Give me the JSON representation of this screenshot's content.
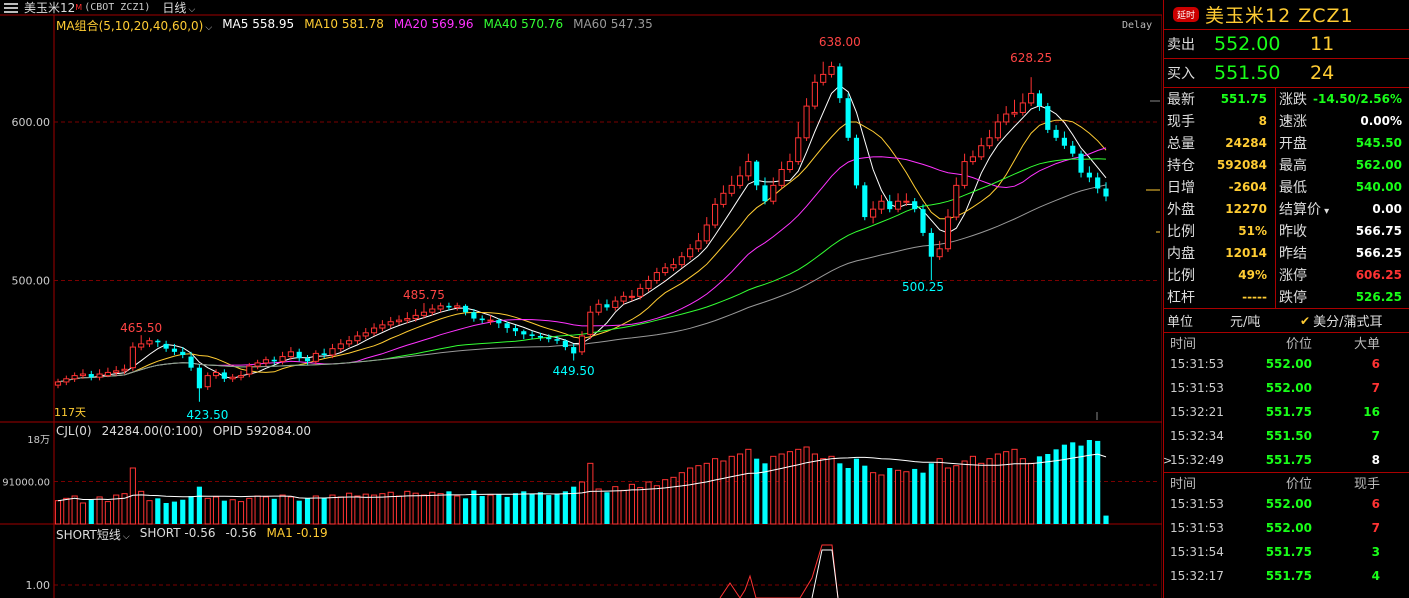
{
  "header": {
    "instrument": "美玉米12",
    "flag": "M",
    "code": "(CBOT ZCZ1)",
    "period": "日线"
  },
  "ma_legend": [
    {
      "label": "MA组合(5,10,20,40,60,0)",
      "color": "#ffcc33"
    },
    {
      "label": "MA5 558.95",
      "color": "#ffffff"
    },
    {
      "label": "MA10 581.78",
      "color": "#ffcc33"
    },
    {
      "label": "MA20 569.96",
      "color": "#ff33ff"
    },
    {
      "label": "MA40 570.76",
      "color": "#33ff33"
    },
    {
      "label": "MA60 547.35",
      "color": "#999999"
    }
  ],
  "delay_label": "Delay",
  "annotations": {
    "days": "117天",
    "high1": "465.50",
    "low1": "423.50",
    "high2": "485.75",
    "low2": "449.50",
    "high3": "638.00",
    "low3": "500.25",
    "high4": "628.25"
  },
  "vol_legend": {
    "name": "CJL(0)",
    "values": "24284.00(0:100)",
    "opid": "OPID 592084.00"
  },
  "short_legend": {
    "name": "SHORT短线",
    "v1": "SHORT -0.56",
    "v2": "-0.56",
    "v3": "MA1 -0.19"
  },
  "colors": {
    "up": "#ff3333",
    "down": "#00ffff",
    "ma5": "#ffffff",
    "ma10": "#ffcc33",
    "ma20": "#ff33ff",
    "ma40": "#33ff33",
    "ma60": "#999999"
  },
  "chart_data": {
    "type": "candlestick",
    "y_price_range": [
      412,
      658
    ],
    "y_ticks": [
      "600.00",
      "500.00"
    ],
    "y_tick_values": [
      600,
      500
    ],
    "vol_ticks": [
      "18万",
      "91000.00"
    ],
    "vol_tick_values": [
      180000,
      91000
    ],
    "vol_range": [
      0,
      180000
    ],
    "short_ticks": [
      "1.00"
    ],
    "price_close": [
      436,
      438,
      440,
      441,
      439,
      441,
      442,
      443,
      444,
      458,
      460,
      462,
      461,
      457,
      455,
      453,
      445,
      432,
      440,
      442,
      438,
      439,
      440,
      446,
      448,
      450,
      449,
      452,
      455,
      451,
      449,
      454,
      453,
      457,
      460,
      462,
      465,
      467,
      470,
      472,
      474,
      475,
      476,
      478,
      480,
      482,
      484,
      483,
      484,
      480,
      476,
      475,
      475,
      473,
      470,
      468,
      466,
      465,
      464,
      463,
      462,
      458,
      454,
      465,
      480,
      485,
      483,
      487,
      490,
      490,
      495,
      500,
      505,
      508,
      510,
      515,
      520,
      525,
      535,
      548,
      555,
      560,
      566,
      575,
      560,
      550,
      560,
      570,
      575,
      590,
      610,
      625,
      630,
      635,
      615,
      590,
      560,
      540,
      545,
      550,
      545,
      550,
      550,
      545,
      530,
      515,
      520,
      540,
      560,
      575,
      578,
      585,
      590,
      600,
      605,
      606,
      612,
      618,
      610,
      595,
      590,
      585,
      580,
      568,
      565,
      558,
      553
    ],
    "price_open": [
      434,
      436,
      438,
      440,
      441,
      439,
      440,
      442,
      443,
      445,
      458,
      460,
      462,
      460,
      457,
      455,
      452,
      445,
      433,
      440,
      442,
      438,
      439,
      441,
      446,
      448,
      450,
      449,
      452,
      455,
      451,
      449,
      454,
      453,
      457,
      460,
      462,
      465,
      467,
      470,
      472,
      474,
      475,
      476,
      478,
      480,
      482,
      484,
      483,
      484,
      480,
      476,
      475,
      475,
      473,
      470,
      468,
      466,
      465,
      464,
      463,
      462,
      458,
      455,
      466,
      480,
      485,
      483,
      487,
      490,
      490,
      495,
      500,
      505,
      508,
      510,
      515,
      520,
      525,
      535,
      548,
      555,
      560,
      566,
      575,
      560,
      550,
      560,
      570,
      575,
      590,
      610,
      625,
      630,
      635,
      615,
      590,
      560,
      540,
      545,
      550,
      545,
      550,
      550,
      545,
      530,
      515,
      520,
      540,
      560,
      575,
      578,
      585,
      590,
      600,
      605,
      606,
      612,
      618,
      610,
      595,
      590,
      585,
      580,
      568,
      565,
      558
    ],
    "price_high": [
      438,
      440,
      442,
      444,
      443,
      444,
      445,
      446,
      447,
      461,
      465.5,
      464,
      463,
      462,
      460,
      458,
      455,
      447,
      442,
      444,
      444,
      441,
      443,
      448,
      450,
      452,
      452,
      455,
      458,
      457,
      453,
      456,
      457,
      460,
      463,
      465,
      468,
      470,
      473,
      475,
      477,
      478,
      480,
      482,
      485.75,
      485,
      486,
      486,
      486,
      485,
      482,
      478,
      478,
      476,
      474,
      472,
      469,
      468,
      467,
      466,
      465,
      463,
      460,
      468,
      484,
      488,
      488,
      490,
      493,
      494,
      498,
      503,
      508,
      511,
      514,
      518,
      523,
      530,
      540,
      552,
      560,
      566,
      572,
      580,
      576,
      565,
      565,
      575,
      580,
      600,
      615,
      630,
      638,
      638,
      637,
      618,
      592,
      562,
      550,
      554,
      554,
      555,
      555,
      552,
      548,
      533,
      525,
      545,
      565,
      580,
      582,
      590,
      595,
      605,
      610,
      614,
      618,
      628.25,
      620,
      612,
      598,
      594,
      588,
      582,
      572,
      568,
      562
    ],
    "price_low": [
      432,
      434,
      436,
      438,
      437,
      437,
      439,
      440,
      441,
      443,
      456,
      458,
      458,
      455,
      453,
      451,
      443,
      423.5,
      431,
      438,
      436,
      436,
      437,
      439,
      444,
      446,
      447,
      447,
      450,
      449,
      447,
      447,
      451,
      451,
      455,
      458,
      460,
      463,
      465,
      468,
      470,
      472,
      473,
      474,
      476,
      478,
      480,
      481,
      481,
      478,
      474,
      473,
      472,
      470,
      467,
      465,
      463,
      463,
      462,
      461,
      460,
      456,
      449.5,
      453,
      463,
      478,
      481,
      481,
      485,
      487,
      488,
      493,
      498,
      503,
      506,
      508,
      513,
      518,
      523,
      533,
      546,
      553,
      558,
      563,
      557,
      548,
      548,
      558,
      568,
      573,
      588,
      608,
      623,
      628,
      612,
      588,
      558,
      538,
      536,
      542,
      543,
      543,
      547,
      543,
      528,
      500.25,
      513,
      518,
      538,
      558,
      573,
      576,
      583,
      588,
      598,
      603,
      604,
      610,
      607,
      593,
      588,
      583,
      578,
      565,
      562,
      555,
      550
    ],
    "vol": [
      50,
      55,
      60,
      45,
      52,
      58,
      48,
      62,
      65,
      120,
      70,
      50,
      55,
      45,
      48,
      52,
      60,
      80,
      55,
      58,
      50,
      52,
      48,
      55,
      60,
      58,
      54,
      62,
      58,
      50,
      55,
      60,
      56,
      62,
      58,
      66,
      60,
      64,
      62,
      65,
      68,
      60,
      70,
      66,
      62,
      68,
      65,
      70,
      60,
      55,
      72,
      60,
      62,
      64,
      58,
      66,
      70,
      65,
      68,
      62,
      64,
      70,
      80,
      90,
      130,
      75,
      68,
      80,
      72,
      85,
      78,
      90,
      82,
      95,
      100,
      110,
      120,
      125,
      130,
      140,
      135,
      145,
      150,
      160,
      140,
      130,
      145,
      150,
      155,
      160,
      165,
      150,
      140,
      145,
      130,
      120,
      140,
      125,
      110,
      105,
      120,
      115,
      112,
      118,
      110,
      130,
      140,
      120,
      125,
      135,
      145,
      130,
      140,
      150,
      155,
      160,
      140,
      130,
      145,
      150,
      160,
      170,
      175,
      168,
      180,
      178,
      18
    ]
  },
  "panel": {
    "title_badge": "延时",
    "title": "美玉米12  ZCZ1",
    "ask": {
      "label": "卖出",
      "price": "552.00",
      "vol": "11"
    },
    "bid": {
      "label": "买入",
      "price": "551.50",
      "vol": "24"
    },
    "quote_left": [
      {
        "label": "最新",
        "value": "551.75",
        "color": "#19ff19"
      },
      {
        "label": "现手",
        "value": "8",
        "color": "#ffcc33"
      },
      {
        "label": "总量",
        "value": "24284",
        "color": "#ffcc33"
      },
      {
        "label": "持仓",
        "value": "592084",
        "color": "#ffcc33"
      },
      {
        "label": "日增",
        "value": "-2604",
        "color": "#ffcc33"
      },
      {
        "label": "外盘",
        "value": "12270",
        "color": "#ffcc33"
      },
      {
        "label": "比例",
        "value": "51%",
        "color": "#ffcc33"
      },
      {
        "label": "内盘",
        "value": "12014",
        "color": "#ffcc33"
      },
      {
        "label": "比例",
        "value": "49%",
        "color": "#ffcc33"
      },
      {
        "label": "杠杆",
        "value": "-----",
        "color": "#ffcc33"
      }
    ],
    "quote_right": [
      {
        "label": "涨跌",
        "value": "-14.50/2.56%",
        "color": "#19ff19"
      },
      {
        "label": "速涨",
        "value": "0.00%",
        "color": "#ffffff"
      },
      {
        "label": "开盘",
        "value": "545.50",
        "color": "#19ff19"
      },
      {
        "label": "最高",
        "value": "562.00",
        "color": "#19ff19"
      },
      {
        "label": "最低",
        "value": "540.00",
        "color": "#19ff19"
      },
      {
        "label": "结算价",
        "value": "0.00",
        "color": "#ffffff"
      },
      {
        "label": "昨收",
        "value": "566.75",
        "color": "#ffffff"
      },
      {
        "label": "昨结",
        "value": "566.25",
        "color": "#ffffff"
      },
      {
        "label": "涨停",
        "value": "606.25",
        "color": "#ff3333"
      },
      {
        "label": "跌停",
        "value": "526.25",
        "color": "#19ff19"
      }
    ],
    "unit": {
      "label": "单位",
      "value": "元/吨",
      "option": "美分/蒲式耳"
    },
    "ticks1": {
      "headers": [
        "时间",
        "价位",
        "大单"
      ],
      "rows": [
        {
          "time": "15:31:53",
          "price": "552.00",
          "vol": "6",
          "vcolor": "#ff3333"
        },
        {
          "time": "15:31:53",
          "price": "552.00",
          "vol": "7",
          "vcolor": "#ff3333"
        },
        {
          "time": "15:32:21",
          "price": "551.75",
          "vol": "16",
          "vcolor": "#19ff19"
        },
        {
          "time": "15:32:34",
          "price": "551.50",
          "vol": "7",
          "vcolor": "#19ff19"
        },
        {
          "time": "15:32:49",
          "price": "551.75",
          "vol": "8",
          "vcolor": "#ffffff"
        }
      ]
    },
    "ticks2": {
      "headers": [
        "时间",
        "价位",
        "现手"
      ],
      "rows": [
        {
          "time": "15:31:53",
          "price": "552.00",
          "vol": "6",
          "vcolor": "#ff3333"
        },
        {
          "time": "15:31:53",
          "price": "552.00",
          "vol": "7",
          "vcolor": "#ff3333"
        },
        {
          "time": "15:31:54",
          "price": "551.75",
          "vol": "3",
          "vcolor": "#19ff19"
        },
        {
          "time": "15:32:17",
          "price": "551.75",
          "vol": "4",
          "vcolor": "#19ff19"
        }
      ]
    }
  }
}
